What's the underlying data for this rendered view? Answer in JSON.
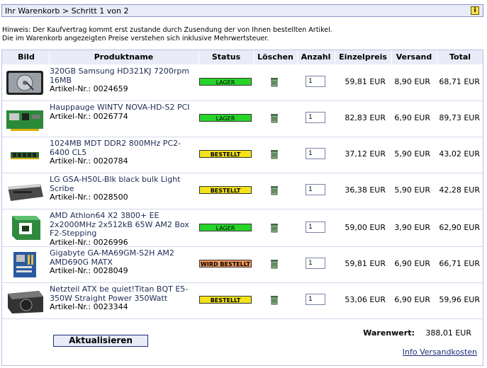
{
  "header": {
    "breadcrumb": "Ihr Warenkorb > Schritt 1 von 2",
    "info_icon_glyph": "i"
  },
  "hint": [
    "Hinweis: Der Kaufvertrag kommt erst zustande durch Zusendung der von Ihnen bestellten Artikel.",
    "Die im Warenkorb angezeigten Preise verstehen sich inklusive Mehrwertsteuer."
  ],
  "columns": {
    "bild": "Bild",
    "produktname": "Produktname",
    "status": "Status",
    "loeschen": "Löschen",
    "anzahl": "Anzahl",
    "einzelpreis": "Einzelpreis",
    "versand": "Versand",
    "total": "Total"
  },
  "items": [
    {
      "name": "320GB Samsung HD321KJ 7200rpm 16MB",
      "artnr": "Artikel-Nr.: 0024659",
      "status": "LAGER",
      "qty": "1",
      "price": "59,81 EUR",
      "shipping": "8,90 EUR",
      "total": "68,71 EUR"
    },
    {
      "name": "Hauppauge WINTV NOVA-HD-S2 PCI",
      "artnr": "Artikel-Nr.: 0026774",
      "status": "LAGER",
      "qty": "1",
      "price": "82,83 EUR",
      "shipping": "6,90 EUR",
      "total": "89,73 EUR"
    },
    {
      "name": "1024MB MDT DDR2 800MHz PC2-6400 CL5",
      "artnr": "Artikel-Nr.: 0020784",
      "status": "BESTELLT",
      "qty": "1",
      "price": "37,12 EUR",
      "shipping": "5,90 EUR",
      "total": "43,02 EUR"
    },
    {
      "name": "LG GSA-H50L-Blk black bulk Light Scribe",
      "artnr": "Artikel-Nr.: 0028500",
      "status": "BESTELLT",
      "qty": "1",
      "price": "36,38 EUR",
      "shipping": "5,90 EUR",
      "total": "42,28 EUR"
    },
    {
      "name": "AMD Athlon64 X2 3800+ EE 2x2000MHz 2x512kB 65W AM2 Box F2-Stepping",
      "artnr": "Artikel-Nr.: 0026996",
      "status": "LAGER",
      "qty": "1",
      "price": "59,00 EUR",
      "shipping": "3,90 EUR",
      "total": "62,90 EUR"
    },
    {
      "name": "Gigabyte GA-MA69GM-S2H AM2 AMD690G MATX",
      "artnr": "Artikel-Nr.: 0028049",
      "status": "WIRD BESTELLT",
      "qty": "1",
      "price": "59,81 EUR",
      "shipping": "6,90 EUR",
      "total": "66,71 EUR"
    },
    {
      "name": "Netzteil ATX be quiet!Titan BQT E5-350W Straight Power 350Watt",
      "artnr": "Artikel-Nr.: 0023344",
      "status": "BESTELLT",
      "qty": "1",
      "price": "53,06 EUR",
      "shipping": "6,90 EUR",
      "total": "59,96 EUR"
    }
  ],
  "footer": {
    "update_label": "Aktualisieren",
    "warenwert_label": "Warenwert:",
    "warenwert_value": "388,01 EUR",
    "ship_info_link": "Info Versandkosten"
  },
  "colors": {
    "lager": "#28d42a",
    "bestellt": "#f2e31a",
    "wird_bestellt": "#f49a5a",
    "header_bg": "#e9ecf8",
    "border": "#b9c0e0"
  }
}
